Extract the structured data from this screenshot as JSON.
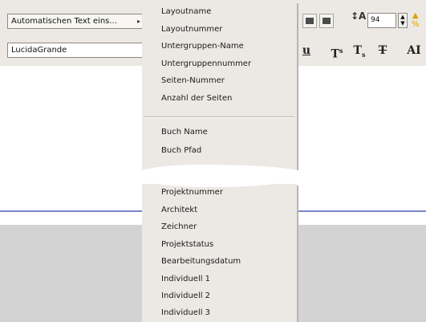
{
  "toolbar": {
    "auto_text_combo": "Automatischen Text eins...",
    "font_combo": "LucidaGrande",
    "font_size": "94",
    "text_buttons": {
      "underline": "u",
      "superscript": "T",
      "subscript": "T",
      "strikethrough": "T",
      "all_caps": "AI"
    }
  },
  "menu": {
    "group1": [
      "Layoutname",
      "Layoutnummer",
      "Untergruppen-Name",
      "Untergruppennummer",
      "Seiten-Nummer",
      "Anzahl der Seiten"
    ],
    "group2": [
      "Buch Name",
      "Buch Pfad"
    ],
    "group3": [
      "Projektnummer",
      "Architekt",
      "Zeichner",
      "Projektstatus",
      "Bearbeitungsdatum",
      "Individuell 1",
      "Individuell 2",
      "Individuell 3"
    ]
  }
}
